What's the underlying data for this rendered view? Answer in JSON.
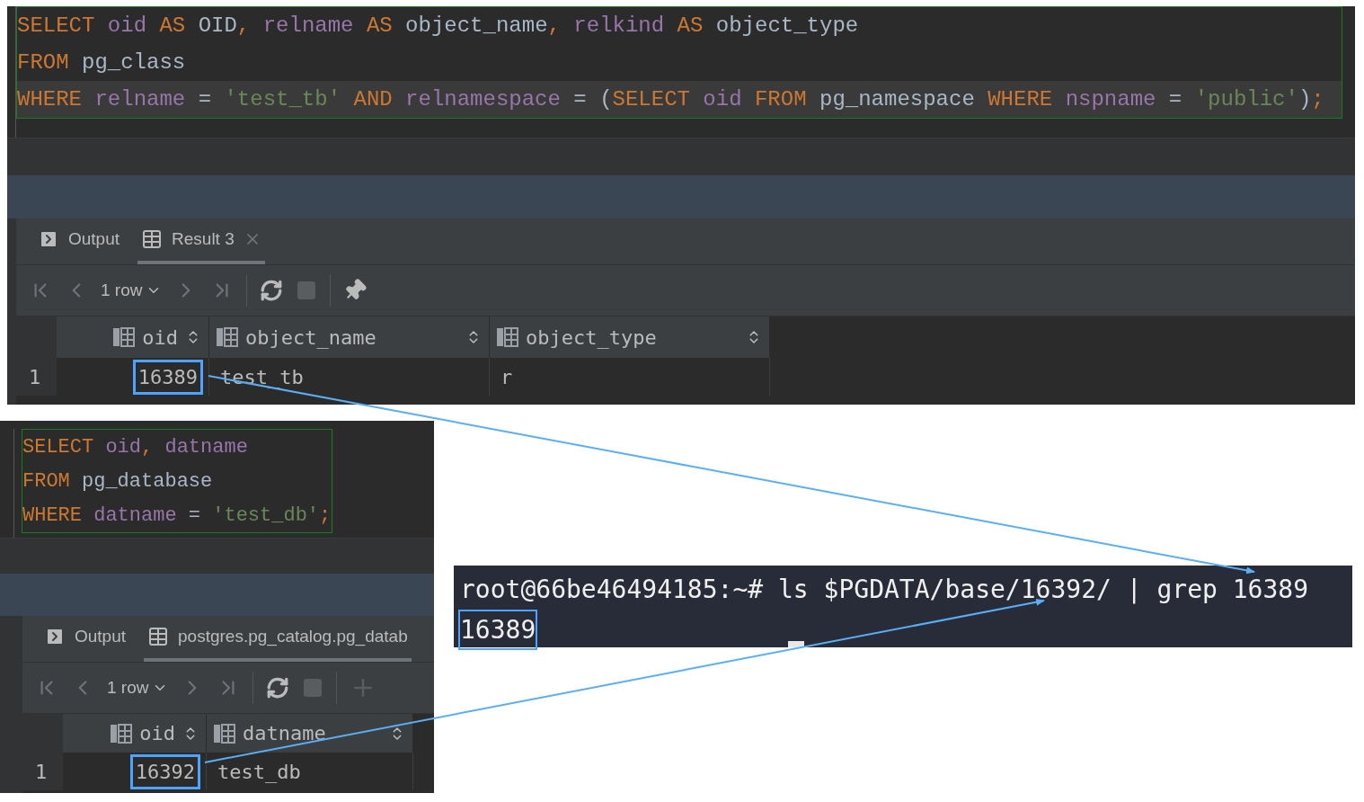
{
  "query_panel": {
    "code_lines": [
      {
        "current": false,
        "tokens": [
          {
            "kind": "keyword",
            "text": "SELECT"
          },
          {
            "kind": "identifier",
            "text": " oid"
          },
          {
            "kind": "keyword",
            "text": " AS"
          },
          {
            "kind": "plain",
            "text": " OID"
          },
          {
            "kind": "keyword",
            "text": ","
          },
          {
            "kind": "identifier",
            "text": " relname"
          },
          {
            "kind": "keyword",
            "text": " AS"
          },
          {
            "kind": "plain",
            "text": " object_name"
          },
          {
            "kind": "keyword",
            "text": ","
          },
          {
            "kind": "identifier",
            "text": " relkind"
          },
          {
            "kind": "keyword",
            "text": " AS"
          },
          {
            "kind": "plain",
            "text": " object_type"
          }
        ]
      },
      {
        "current": false,
        "tokens": [
          {
            "kind": "keyword",
            "text": "FROM"
          },
          {
            "kind": "plain",
            "text": " pg_class"
          }
        ]
      },
      {
        "current": true,
        "tokens": [
          {
            "kind": "keyword",
            "text": "WHERE"
          },
          {
            "kind": "identifier",
            "text": " relname"
          },
          {
            "kind": "plain",
            "text": " ="
          },
          {
            "kind": "string",
            "text": " 'test_tb'"
          },
          {
            "kind": "keyword",
            "text": " AND"
          },
          {
            "kind": "identifier",
            "text": " relnamespace"
          },
          {
            "kind": "plain",
            "text": " = ("
          },
          {
            "kind": "keyword",
            "text": "SELECT"
          },
          {
            "kind": "identifier",
            "text": " oid"
          },
          {
            "kind": "keyword",
            "text": " FROM"
          },
          {
            "kind": "plain",
            "text": " pg_namespace"
          },
          {
            "kind": "keyword",
            "text": " WHERE"
          },
          {
            "kind": "identifier",
            "text": " nspname"
          },
          {
            "kind": "plain",
            "text": " ="
          },
          {
            "kind": "string",
            "text": " 'public'"
          },
          {
            "kind": "plain",
            "text": ")"
          },
          {
            "kind": "keyword",
            "text": ";"
          }
        ]
      }
    ],
    "tabs": [
      {
        "label": "Output",
        "selected": false,
        "closable": false
      },
      {
        "label": "Result 3",
        "selected": true,
        "closable": true
      }
    ],
    "row_count": "1 row",
    "columns": [
      {
        "name": "oid"
      },
      {
        "name": "object_name"
      },
      {
        "name": "object_type"
      }
    ],
    "rows": [
      {
        "number": "1",
        "cells": [
          {
            "text": "16389",
            "highlighted": true
          },
          {
            "text": "test_tb",
            "highlighted": false
          },
          {
            "text": "r",
            "highlighted": false
          }
        ]
      }
    ]
  },
  "database_panel": {
    "code_lines": [
      {
        "current": false,
        "tokens": [
          {
            "kind": "keyword",
            "text": "SELECT"
          },
          {
            "kind": "identifier",
            "text": " oid"
          },
          {
            "kind": "keyword",
            "text": ","
          },
          {
            "kind": "identifier",
            "text": " datname"
          }
        ]
      },
      {
        "current": false,
        "tokens": [
          {
            "kind": "keyword",
            "text": "FROM"
          },
          {
            "kind": "plain",
            "text": " pg_database"
          }
        ]
      },
      {
        "current": false,
        "tokens": [
          {
            "kind": "keyword",
            "text": "WHERE"
          },
          {
            "kind": "identifier",
            "text": " datname"
          },
          {
            "kind": "plain",
            "text": " ="
          },
          {
            "kind": "string",
            "text": " 'test_db'"
          },
          {
            "kind": "keyword",
            "text": ";"
          }
        ]
      }
    ],
    "tabs": [
      {
        "label": "Output",
        "selected": false,
        "closable": false
      },
      {
        "label": "postgres.pg_catalog.pg_datab",
        "selected": true,
        "closable": false
      }
    ],
    "row_count": "1 row",
    "columns": [
      {
        "name": "oid"
      },
      {
        "name": "datname"
      }
    ],
    "rows": [
      {
        "number": "1",
        "cells": [
          {
            "text": "16392",
            "highlighted": true
          },
          {
            "text": "test_db",
            "highlighted": false
          }
        ]
      }
    ]
  },
  "terminal": {
    "lines": [
      {
        "text": "root@66be46494185:~# ls $PGDATA/base/16392/ | grep 16389",
        "highlighted": false
      },
      {
        "text": "16389",
        "highlighted": true
      }
    ]
  }
}
